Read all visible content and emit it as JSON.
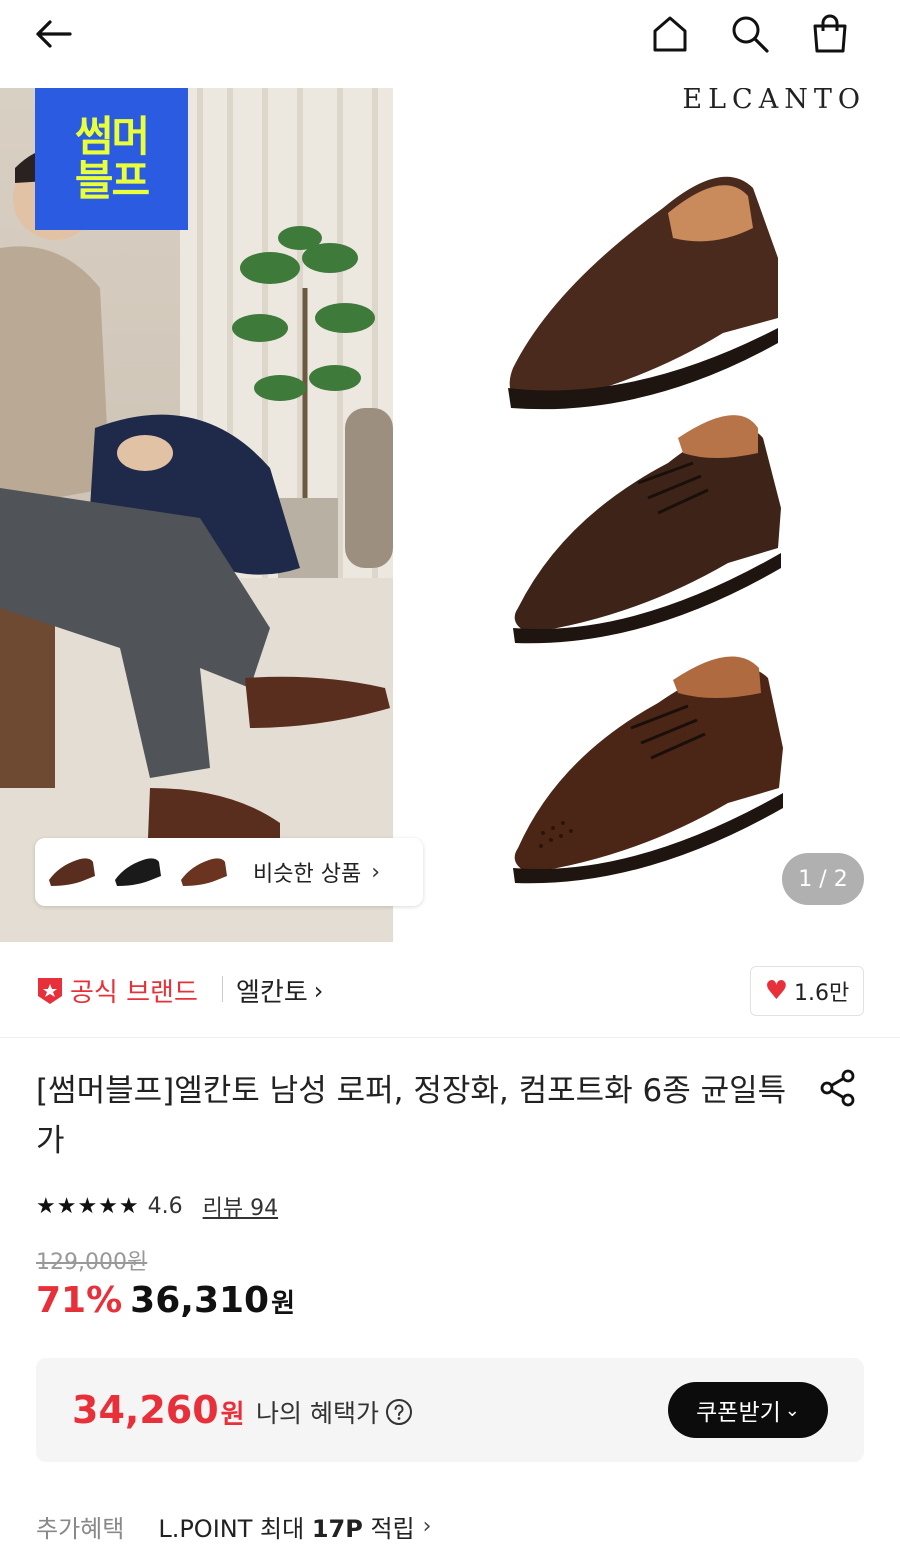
{
  "header": {
    "back_icon": "back-arrow-icon",
    "home_icon": "home-icon",
    "search_icon": "search-icon",
    "bag_icon": "shopping-bag-icon"
  },
  "hero": {
    "promo_badge_line1": "썸머",
    "promo_badge_line2": "블프",
    "brand_wordmark": "ELCANTO",
    "similar_products_label": "비슷한 상품",
    "page_indicator": "1 / 2"
  },
  "brand_row": {
    "official_label": "공식 브랜드",
    "brand_name": "엘칸토",
    "likes": "1.6만"
  },
  "product": {
    "title": "[썸머블프]엘칸토 남성 로퍼, 정장화, 컴포트화 6종 균일특가",
    "rating": "4.6",
    "review_label": "리뷰 94",
    "original_price": "129,000원",
    "discount": "71%",
    "sale_price": "36,310",
    "sale_unit": "원"
  },
  "benefit": {
    "my_price": "34,260",
    "my_price_unit": "원",
    "label": "나의 혜택가",
    "coupon_button": "쿠폰받기"
  },
  "extra": {
    "label": "추가혜택",
    "text_prefix": "L.POINT 최대 ",
    "text_bold": "17P",
    "text_suffix": " 적립"
  },
  "colors": {
    "accent_red": "#e8303a",
    "promo_blue": "#2b5be0",
    "promo_yellow": "#e8ff3a"
  }
}
